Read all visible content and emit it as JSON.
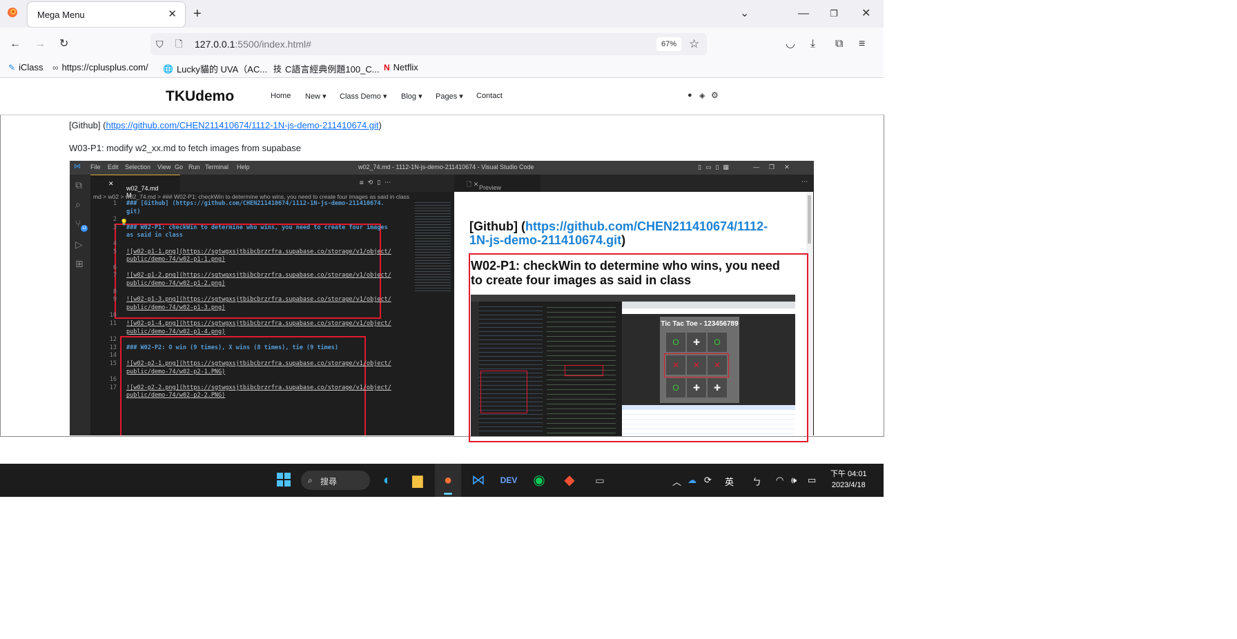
{
  "browser": {
    "tab_title": "Mega Menu",
    "tab_close": "✕",
    "new_tab": "+",
    "url_host": "127.0.0.1",
    "url_rest": ":5500/index.html#",
    "zoom": "67%",
    "bookmarks": [
      "iClass",
      "https://cplusplus.com/",
      "Lucky貓的 UVA（AC...",
      "C語言經典例題100_C...",
      "Netflix"
    ]
  },
  "site": {
    "brand": "TKUdemo",
    "nav": [
      "Home",
      "New",
      "Class Demo",
      "Blog",
      "Pages",
      "Contact"
    ],
    "github_prefix": "[Github] (",
    "github_url": "https://github.com/CHEN211410674/1112-1N-js-demo-211410674.git",
    "github_suffix": ")",
    "w03_text": "W03-P1: modify w2_xx.md to fetch images from supabase"
  },
  "vscode": {
    "menu": [
      "File",
      "Edit",
      "Selection",
      "View",
      "Go",
      "Run",
      "Terminal",
      "Help"
    ],
    "window_title": "w02_74.md - 1112-1N-js-demo-211410674 - Visual Studio Code",
    "tab": "w02_74.md M",
    "breadcrumb": "md > w02 > w02_74.md > ### W02-P1: checkWin to determine who wins, you need to create four images as said in class",
    "preview_tab": "Preview w02_74.md",
    "scm_badge": "12",
    "lines": [
      {
        "n": "1",
        "t": "### [Github] (https://github.com/CHEN211410674/1112-1N-js-demo-211410674."
      },
      {
        "n": "",
        "t": "git)"
      },
      {
        "n": "2",
        "t": ""
      },
      {
        "n": "3",
        "t": "### W02-P1: checkWin to determine who wins, you need to create four images"
      },
      {
        "n": "",
        "t": "as said in class"
      },
      {
        "n": "4",
        "t": ""
      },
      {
        "n": "5",
        "t": "![w02-p1-1.png](https://sgtwgxsjtbibcbrzrfra.supabase.co/storage/v1/object/"
      },
      {
        "n": "",
        "t": "public/demo-74/w02-p1-1.png)"
      },
      {
        "n": "6",
        "t": ""
      },
      {
        "n": "7",
        "t": "![w02-p1-2.png](https://sgtwgxsjtbibcbrzrfra.supabase.co/storage/v1/object/"
      },
      {
        "n": "",
        "t": "public/demo-74/w02-p1-2.png)"
      },
      {
        "n": "8",
        "t": ""
      },
      {
        "n": "9",
        "t": "![w02-p1-3.png](https://sgtwgxsjtbibcbrzrfra.supabase.co/storage/v1/object/"
      },
      {
        "n": "",
        "t": "public/demo-74/w02-p1-3.png)"
      },
      {
        "n": "10",
        "t": ""
      },
      {
        "n": "11",
        "t": "![w02-p1-4.png](https://sgtwgxsjtbibcbrzrfra.supabase.co/storage/v1/object/"
      },
      {
        "n": "",
        "t": "public/demo-74/w02-p1-4.png)"
      },
      {
        "n": "12",
        "t": ""
      },
      {
        "n": "13",
        "t": "### W02-P2: O win (9 times), X wins (8 times), tie (9 times)"
      },
      {
        "n": "14",
        "t": ""
      },
      {
        "n": "15",
        "t": "![w02-p2-1.png](https://sgtwgxsjtbibcbrzrfra.supabase.co/storage/v1/object/"
      },
      {
        "n": "",
        "t": "public/demo-74/w02-p2-1.PNG)"
      },
      {
        "n": "16",
        "t": ""
      },
      {
        "n": "17",
        "t": "![w02-p2-2.png](https://sgtwgxsjtbibcbrzrfra.supabase.co/storage/v1/object/"
      },
      {
        "n": "",
        "t": "public/demo-74/w02-p2-2.PNG)"
      }
    ],
    "preview_h3_prefix": "[Github] (",
    "preview_h3_link": "https://github.com/CHEN211410674/1112-1N-js-demo-211410674.git",
    "preview_h3_suffix": ")",
    "preview_h2": "W02-P1: checkWin to determine who wins, you need to create four images as said in class",
    "ttt_title": "Tic Tac Toe - 123456789",
    "ttt_cells": [
      "O",
      "✚",
      "O",
      "✕",
      "✕",
      "✕",
      "O",
      "✚",
      "✚"
    ]
  },
  "taskbar": {
    "search_label": "搜尋",
    "ime": "英",
    "time": "下午 04:01",
    "date": "2023/4/18"
  }
}
